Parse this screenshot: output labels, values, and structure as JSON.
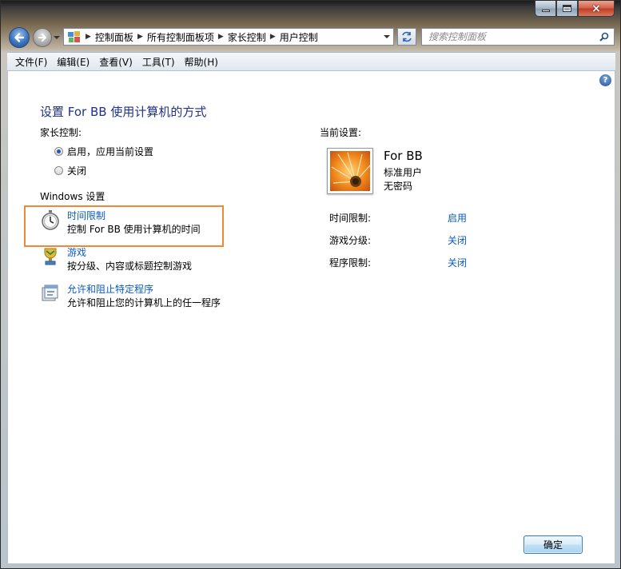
{
  "window": {
    "caption_close": "×"
  },
  "address": {
    "crumbs": [
      "控制面板",
      "所有控制面板项",
      "家长控制",
      "用户控制"
    ],
    "search_placeholder": "搜索控制面板"
  },
  "menu": {
    "items": [
      "文件(F)",
      "编辑(E)",
      "查看(V)",
      "工具(T)",
      "帮助(H)"
    ]
  },
  "page": {
    "title": "设置 For BB 使用计算机的方式",
    "parental_controls_label": "家长控制:",
    "radio_on": "启用，应用当前设置",
    "radio_off": "关闭",
    "windows_settings_label": "Windows 设置",
    "settings": [
      {
        "link": "时间限制",
        "desc": "控制 For BB 使用计算机的时间",
        "icon": "stopwatch-icon"
      },
      {
        "link": "游戏",
        "desc": "按分级、内容或标题控制游戏",
        "icon": "game-trophy-icon"
      },
      {
        "link": "允许和阻止特定程序",
        "desc": "允许和阻止您的计算机上的任一程序",
        "icon": "program-block-icon"
      }
    ]
  },
  "current": {
    "label": "当前设置:",
    "user_name": "For BB",
    "account_type": "标准用户",
    "password_status": "无密码",
    "limits": [
      {
        "label": "时间限制:",
        "value": "启用"
      },
      {
        "label": "游戏分级:",
        "value": "关闭"
      },
      {
        "label": "程序限制:",
        "value": "关闭"
      }
    ]
  },
  "buttons": {
    "ok": "确定"
  },
  "colors": {
    "link": "#0a5bc4",
    "title": "#1e3287",
    "highlight": "#f0883a"
  }
}
